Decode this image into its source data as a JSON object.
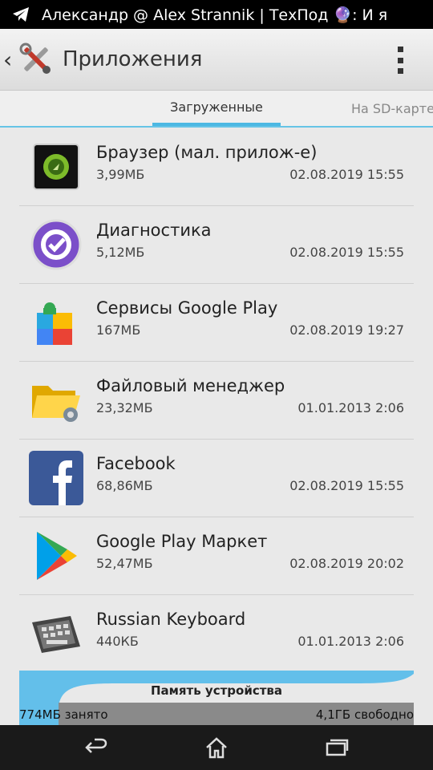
{
  "status_bar": {
    "notification_text": "Александр @ Alex Strannik | ТехПод 🔮: И я"
  },
  "app_bar": {
    "title": "Приложения"
  },
  "tabs": [
    {
      "label": "Загруженные",
      "selected": true
    },
    {
      "label": "На SD-карте",
      "selected": false
    }
  ],
  "apps": [
    {
      "name": "Браузер (мал. прилож-е)",
      "size": "3,99МБ",
      "date": "02.08.2019 15:55",
      "icon": "browser-icon"
    },
    {
      "name": "Диагностика",
      "size": "5,12МБ",
      "date": "02.08.2019 15:55",
      "icon": "diagnostics-icon"
    },
    {
      "name": "Сервисы Google Play",
      "size": "167МБ",
      "date": "02.08.2019 19:27",
      "icon": "google-play-services-icon"
    },
    {
      "name": "Файловый менеджер",
      "size": "23,32МБ",
      "date": "01.01.2013 2:06",
      "icon": "file-manager-icon"
    },
    {
      "name": "Facebook",
      "size": "68,86МБ",
      "date": "02.08.2019 15:55",
      "icon": "facebook-icon"
    },
    {
      "name": "Google Play Маркет",
      "size": "52,47МБ",
      "date": "02.08.2019 20:02",
      "icon": "google-play-market-icon"
    },
    {
      "name": "Russian Keyboard",
      "size": "440КБ",
      "date": "01.01.2013 2:06",
      "icon": "keyboard-icon"
    }
  ],
  "memory": {
    "title": "Память устройства",
    "used_label": "774МБ занято",
    "free_label": "4,1ГБ свободно",
    "used_fraction": 0.1
  },
  "colors": {
    "accent": "#4cb8e3",
    "memory_used": "#63bfea",
    "memory_free": "#8a8a8a"
  }
}
